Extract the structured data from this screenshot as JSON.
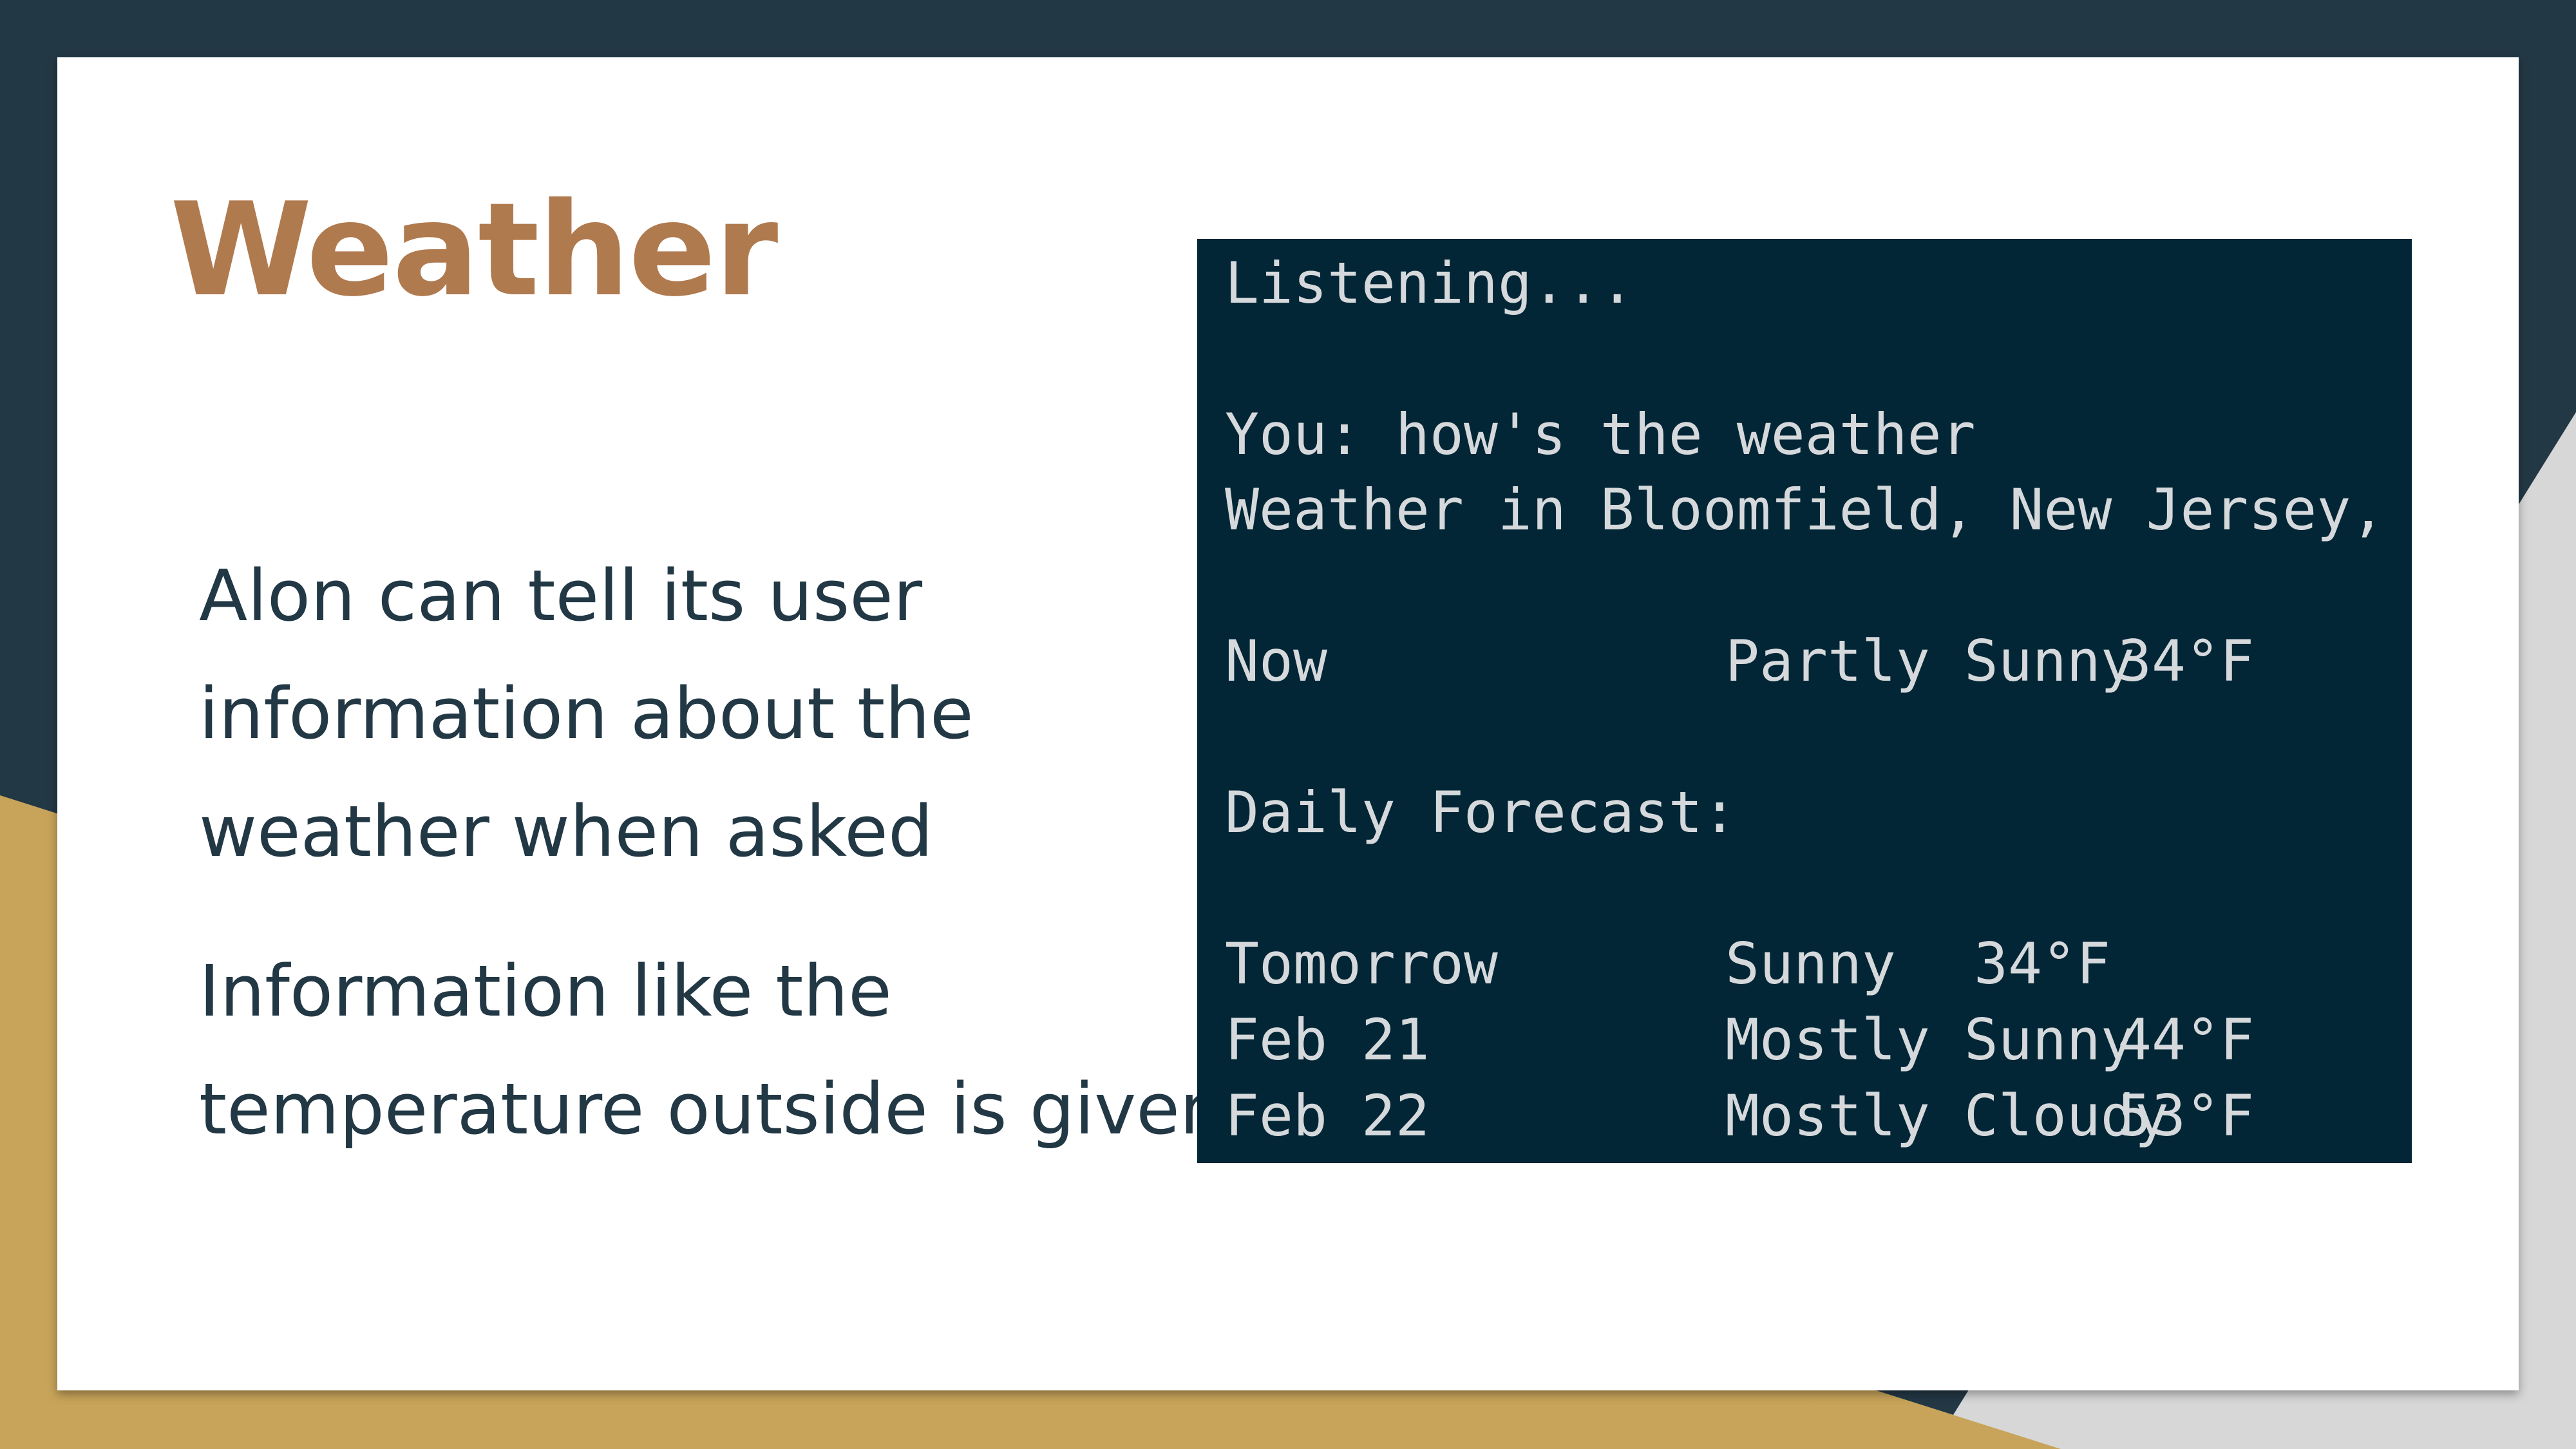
{
  "slide": {
    "title": "Weather",
    "paragraphs": [
      "Alon can tell its user\ninformation about the\nweather when asked",
      "Information like the\ntemperature outside is given"
    ]
  },
  "terminal": {
    "listening": "Listening...",
    "user_query": "You: how's the weather",
    "location_header": "Weather in Bloomfield, New Jersey, US:",
    "current": {
      "label": "Now",
      "condition": "Partly Sunny",
      "temperature": "34°F"
    },
    "daily_forecast_header": "Daily Forecast:",
    "forecast": [
      {
        "day": "Tomorrow",
        "condition": "Sunny",
        "temperature": "34°F"
      },
      {
        "day": "Feb 21",
        "condition": "Mostly Sunny",
        "temperature": "44°F"
      },
      {
        "day": "Feb 22",
        "condition": "Mostly Cloudy",
        "temperature": "53°F"
      }
    ]
  },
  "colors": {
    "background_dark": "#233845",
    "accent_gold": "#c8a45a",
    "title_brown": "#b07a4f",
    "terminal_bg": "#022636",
    "terminal_text": "#d6d9dc"
  }
}
